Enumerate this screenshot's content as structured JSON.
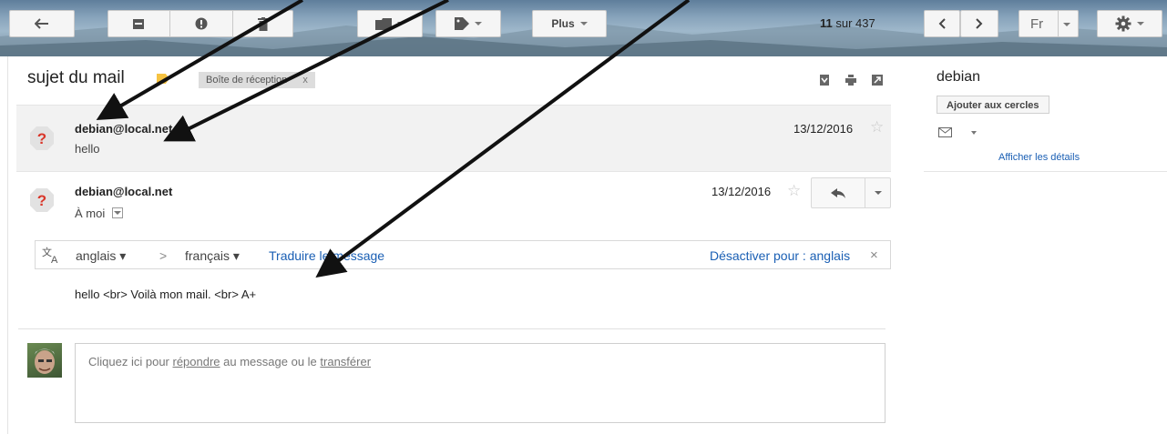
{
  "toolbar": {
    "back_icon": "back-arrow-icon",
    "archive_icon": "archive-icon",
    "spam_icon": "report-spam-icon",
    "delete_icon": "trash-icon",
    "move_icon": "folder-icon",
    "labels_icon": "label-tag-icon",
    "more_label": "Plus",
    "pager_current": "11",
    "pager_total": "sur 437",
    "language_label": "Fr",
    "settings_icon": "gear-icon"
  },
  "subject": {
    "title": "sujet du mail",
    "label_chip": "Boîte de réception",
    "label_chip_close": "x"
  },
  "messages": [
    {
      "sender": "debian@local.net",
      "snippet": "hello",
      "date": "13/12/2016"
    },
    {
      "sender": "debian@local.net",
      "recipient": "À moi",
      "date": "13/12/2016"
    }
  ],
  "translate": {
    "from": "anglais ▾",
    "arrow": ">",
    "to": "français ▾",
    "action": "Traduire le message",
    "disable": "Désactiver pour : anglais",
    "close": "×"
  },
  "body": {
    "text": "hello <br> Voilà mon mail. <br> A+"
  },
  "reply": {
    "prefix": "Cliquez ici pour ",
    "reply_link": "répondre",
    "middle": " au message ou le ",
    "forward_link": "transférer"
  },
  "sidebar": {
    "name": "debian",
    "add_circles": "Ajouter aux cercles",
    "details_link": "Afficher les détails"
  },
  "colors": {
    "accent_link": "#1a5fb4",
    "annotation_arrow": "#111111"
  }
}
